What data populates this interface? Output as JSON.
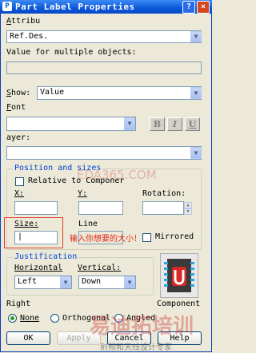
{
  "window": {
    "title": "Part Label Properties",
    "help_glyph": "?",
    "close_glyph": "×",
    "title_icon_glyph": "P"
  },
  "attribute": {
    "label_prefix": "",
    "label_accel": "A",
    "label_rest": "ttribu",
    "value": "Ref.Des."
  },
  "multi": {
    "label": "Value for multiple objects:",
    "value": ""
  },
  "show": {
    "label_accel": "S",
    "label_rest": "how:",
    "value": "Value"
  },
  "font": {
    "label_accel": "F",
    "label_rest": "ont",
    "value": "",
    "bold": "B",
    "italic": "I",
    "underline": "U"
  },
  "layer": {
    "label": "ayer:",
    "value": ""
  },
  "position_group": {
    "title": "Position and sizes",
    "relative_label": "Relative to Componer",
    "relative_accel": "t",
    "x_label": "X:",
    "y_label": "Y:",
    "rotation_label": "Rotation:",
    "x_value": "",
    "y_value": "",
    "rotation_value": "",
    "size_label": "Size:",
    "size_value": "|",
    "line_label": "Line",
    "mirrored_label": "Mirrored"
  },
  "justification_group": {
    "title": "Justification",
    "horizontal_label": "Horizontal",
    "horizontal_value": "Left",
    "vertical_label": "Vertical:",
    "vertical_value": "Down"
  },
  "component_label": "Component",
  "right": {
    "label": "Right",
    "options": [
      "None",
      "Orthogonal",
      "Angled"
    ],
    "selected": "None"
  },
  "buttons": {
    "ok": "OK",
    "apply": "Apply",
    "cancel": "Cancel",
    "help": "Help"
  },
  "annotation": "输入你想要的大小！",
  "watermarks": {
    "mid": "EDA365.COM",
    "bottom_big": "易迪拓培训",
    "bottom_small": "射频和天线设计专家"
  },
  "colors": {
    "title_bar": "#0a58d8",
    "face": "#ece9d8",
    "group_title": "#0046d5",
    "annotation": "#e2281a"
  }
}
